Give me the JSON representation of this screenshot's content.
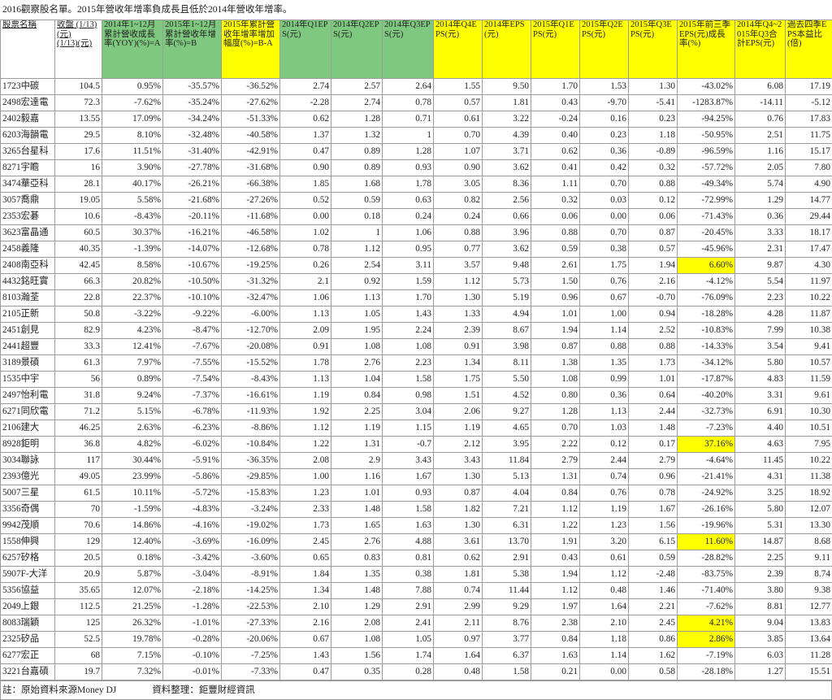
{
  "title": "2016觀察股名單。2015年營收年增率負成長且低於2014年營收年增率。",
  "colors": {
    "header_green": "#7fc87f",
    "header_yellow": "#ffff00",
    "highlight": "#ffff00",
    "grid": "#9b9b9b"
  },
  "columns": [
    {
      "label": "股票名稱",
      "style": "plain",
      "underline": true
    },
    {
      "label": "收盤\n(1/13)(元)",
      "style": "plain",
      "underline": true
    },
    {
      "label": "2014年1~12月累計營收成長率(YOY)(%)=A",
      "style": "green"
    },
    {
      "label": "2015年1~12月累計營收年增率(%)=B",
      "style": "green"
    },
    {
      "label": "2015年累計營收年增率增加幅度(%)=B-A",
      "style": "yellow"
    },
    {
      "label": "2014年Q1EPS(元)",
      "style": "green"
    },
    {
      "label": "2014年Q2EPS(元)",
      "style": "green"
    },
    {
      "label": "2014年Q3EPS(元)",
      "style": "green"
    },
    {
      "label": "2014年Q4EPS(元)",
      "style": "yellow"
    },
    {
      "label": "2014年EPS(元)",
      "style": "yellow"
    },
    {
      "label": "2015年Q1EPS(元)",
      "style": "yellow"
    },
    {
      "label": "2015年Q2EPS(元)",
      "style": "yellow"
    },
    {
      "label": "2015年Q3EPS(元)",
      "style": "yellow"
    },
    {
      "label": "2015年前三季EPS(元)成長率(%)",
      "style": "yellow"
    },
    {
      "label": "2014年Q4~2015年Q3合計EPS(元)",
      "style": "yellow"
    },
    {
      "label": "過去四季EPS本益比(倍)",
      "style": "yellow"
    }
  ],
  "rows": [
    {
      "cells": [
        "1723中碳",
        "104.5",
        "0.95%",
        "-35.57%",
        "-36.52%",
        "2.74",
        "2.57",
        "2.64",
        "1.55",
        "9.50",
        "1.70",
        "1.53",
        "1.30",
        "-43.02%",
        "6.08",
        "17.19"
      ],
      "mark": false
    },
    {
      "cells": [
        "2498宏達電",
        "72.3",
        "-7.62%",
        "-35.24%",
        "-27.62%",
        "-2.28",
        "2.74",
        "0.78",
        "0.57",
        "1.81",
        "0.43",
        "-9.70",
        "-5.41",
        "-1283.87%",
        "-14.11",
        "-5.12"
      ],
      "mark": false
    },
    {
      "cells": [
        "2402毅嘉",
        "13.55",
        "17.09%",
        "-34.24%",
        "-51.33%",
        "0.62",
        "1.28",
        "0.71",
        "0.61",
        "3.22",
        "-0.24",
        "0.16",
        "0.23",
        "-94.25%",
        "0.76",
        "17.83"
      ],
      "mark": false
    },
    {
      "cells": [
        "6203海韻電",
        "29.5",
        "8.10%",
        "-32.48%",
        "-40.58%",
        "1.37",
        "1.32",
        "1",
        "0.70",
        "4.39",
        "0.40",
        "0.23",
        "1.18",
        "-50.95%",
        "2.51",
        "11.75"
      ],
      "mark": false
    },
    {
      "cells": [
        "3265台星科",
        "17.6",
        "11.51%",
        "-31.40%",
        "-42.91%",
        "0.47",
        "0.89",
        "1.28",
        "1.07",
        "3.71",
        "0.62",
        "0.36",
        "-0.89",
        "-96.59%",
        "1.16",
        "15.17"
      ],
      "mark": false
    },
    {
      "cells": [
        "8271宇瞻",
        "16",
        "3.90%",
        "-27.78%",
        "-31.68%",
        "0.90",
        "0.89",
        "0.93",
        "0.90",
        "3.62",
        "0.41",
        "0.42",
        "0.32",
        "-57.72%",
        "2.05",
        "7.80"
      ],
      "mark": false
    },
    {
      "cells": [
        "3474華亞科",
        "28.1",
        "40.17%",
        "-26.21%",
        "-66.38%",
        "1.85",
        "1.68",
        "1.78",
        "3.05",
        "8.36",
        "1.11",
        "0.70",
        "0.88",
        "-49.34%",
        "5.74",
        "4.90"
      ],
      "mark": false
    },
    {
      "cells": [
        "3057喬鼎",
        "19.05",
        "5.58%",
        "-21.68%",
        "-27.26%",
        "0.52",
        "0.59",
        "0.63",
        "0.82",
        "2.56",
        "0.32",
        "0.03",
        "0.12",
        "-72.99%",
        "1.29",
        "14.77"
      ],
      "mark": false
    },
    {
      "cells": [
        "2353宏碁",
        "10.6",
        "-8.43%",
        "-20.11%",
        "-11.68%",
        "0.00",
        "0.18",
        "0.24",
        "0.24",
        "0.66",
        "0.06",
        "0.00",
        "0.06",
        "-71.43%",
        "0.36",
        "29.44"
      ],
      "mark": false
    },
    {
      "cells": [
        "3623富晶通",
        "60.5",
        "30.37%",
        "-16.21%",
        "-46.58%",
        "1.02",
        "1",
        "1.06",
        "0.88",
        "3.96",
        "0.88",
        "0.70",
        "0.87",
        "-20.45%",
        "3.33",
        "18.17"
      ],
      "mark": false
    },
    {
      "cells": [
        "2458義隆",
        "40.35",
        "-1.39%",
        "-14.07%",
        "-12.68%",
        "0.78",
        "1.12",
        "0.95",
        "0.77",
        "3.62",
        "0.59",
        "0.38",
        "0.57",
        "-45.96%",
        "2.31",
        "17.47"
      ],
      "mark": false
    },
    {
      "cells": [
        "2408南亞科",
        "42.45",
        "8.58%",
        "-10.67%",
        "-19.25%",
        "0.26",
        "2.54",
        "3.11",
        "3.57",
        "9.48",
        "2.61",
        "1.75",
        "1.94",
        "6.60%",
        "9.87",
        "4.30"
      ],
      "mark": true
    },
    {
      "cells": [
        "4432銘旺實",
        "66.3",
        "20.82%",
        "-10.50%",
        "-31.32%",
        "2.1",
        "0.92",
        "1.59",
        "1.12",
        "5.73",
        "1.50",
        "0.76",
        "2.16",
        "-4.12%",
        "5.54",
        "11.97"
      ],
      "mark": false
    },
    {
      "cells": [
        "8103瀚荃",
        "22.8",
        "22.37%",
        "-10.10%",
        "-32.47%",
        "1.06",
        "1.13",
        "1.70",
        "1.30",
        "5.19",
        "0.96",
        "0.67",
        "-0.70",
        "-76.09%",
        "2.23",
        "10.22"
      ],
      "mark": false
    },
    {
      "cells": [
        "2105正新",
        "50.8",
        "-3.22%",
        "-9.22%",
        "-6.00%",
        "1.13",
        "1.05",
        "1.43",
        "1.33",
        "4.94",
        "1.01",
        "1.00",
        "0.94",
        "-18.28%",
        "4.28",
        "11.87"
      ],
      "mark": false
    },
    {
      "cells": [
        "2451創見",
        "82.9",
        "4.23%",
        "-8.47%",
        "-12.70%",
        "2.09",
        "1.95",
        "2.24",
        "2.39",
        "8.67",
        "1.94",
        "1.14",
        "2.52",
        "-10.83%",
        "7.99",
        "10.38"
      ],
      "mark": false
    },
    {
      "cells": [
        "2441超豐",
        "33.3",
        "12.41%",
        "-7.67%",
        "-20.08%",
        "0.91",
        "1.08",
        "1.08",
        "0.91",
        "3.98",
        "0.87",
        "0.88",
        "0.88",
        "-14.33%",
        "3.54",
        "9.41"
      ],
      "mark": false
    },
    {
      "cells": [
        "3189景碩",
        "61.3",
        "7.97%",
        "-7.55%",
        "-15.52%",
        "1.78",
        "2.76",
        "2.23",
        "1.34",
        "8.11",
        "1.38",
        "1.35",
        "1.73",
        "-34.12%",
        "5.80",
        "10.57"
      ],
      "mark": false
    },
    {
      "cells": [
        "1535中宇",
        "56",
        "0.89%",
        "-7.54%",
        "-8.43%",
        "1.13",
        "1.04",
        "1.58",
        "1.75",
        "5.50",
        "1.08",
        "0.99",
        "1.01",
        "-17.87%",
        "4.83",
        "11.59"
      ],
      "mark": false
    },
    {
      "cells": [
        "2497怡利電",
        "31.8",
        "9.24%",
        "-7.37%",
        "-16.61%",
        "1.19",
        "0.84",
        "0.98",
        "1.51",
        "4.52",
        "0.80",
        "0.36",
        "0.64",
        "-40.20%",
        "3.31",
        "9.61"
      ],
      "mark": false
    },
    {
      "cells": [
        "6271同欣電",
        "71.2",
        "5.15%",
        "-6.78%",
        "-11.93%",
        "1.92",
        "2.25",
        "3.04",
        "2.06",
        "9.27",
        "1.28",
        "1.13",
        "2.44",
        "-32.73%",
        "6.91",
        "10.30"
      ],
      "mark": false
    },
    {
      "cells": [
        "2106建大",
        "46.25",
        "2.63%",
        "-6.23%",
        "-8.86%",
        "1.12",
        "1.19",
        "1.15",
        "1.19",
        "4.65",
        "0.70",
        "1.03",
        "1.48",
        "-7.23%",
        "4.40",
        "10.51"
      ],
      "mark": false
    },
    {
      "cells": [
        "8928鉅明",
        "36.8",
        "4.82%",
        "-6.02%",
        "-10.84%",
        "1.22",
        "1.31",
        "-0.7",
        "2.12",
        "3.95",
        "2.22",
        "0.12",
        "0.17",
        "37.16%",
        "4.63",
        "7.95"
      ],
      "mark": true
    },
    {
      "cells": [
        "3034聯詠",
        "117",
        "30.44%",
        "-5.91%",
        "-36.35%",
        "2.08",
        "2.9",
        "3.43",
        "3.43",
        "11.84",
        "2.79",
        "2.44",
        "2.79",
        "-4.64%",
        "11.45",
        "10.22"
      ],
      "mark": false
    },
    {
      "cells": [
        "2393億光",
        "49.05",
        "23.99%",
        "-5.86%",
        "-29.85%",
        "1.00",
        "1.16",
        "1.67",
        "1.30",
        "5.13",
        "1.31",
        "0.74",
        "0.96",
        "-21.41%",
        "4.31",
        "11.38"
      ],
      "mark": false
    },
    {
      "cells": [
        "5007三星",
        "61.5",
        "10.11%",
        "-5.72%",
        "-15.83%",
        "1.23",
        "1.01",
        "0.93",
        "0.87",
        "4.04",
        "0.84",
        "0.76",
        "0.78",
        "-24.92%",
        "3.25",
        "18.92"
      ],
      "mark": false
    },
    {
      "cells": [
        "3356奇偶",
        "70",
        "-1.59%",
        "-4.83%",
        "-3.24%",
        "2.33",
        "1.48",
        "1.58",
        "1.82",
        "7.21",
        "1.12",
        "1.19",
        "1.67",
        "-26.16%",
        "5.80",
        "12.07"
      ],
      "mark": false
    },
    {
      "cells": [
        "9942茂順",
        "70.6",
        "14.86%",
        "-4.16%",
        "-19.02%",
        "1.73",
        "1.65",
        "1.63",
        "1.30",
        "6.31",
        "1.22",
        "1.23",
        "1.56",
        "-19.96%",
        "5.31",
        "13.30"
      ],
      "mark": false
    },
    {
      "cells": [
        "1558伸興",
        "129",
        "12.40%",
        "-3.69%",
        "-16.09%",
        "2.45",
        "2.76",
        "4.88",
        "3.61",
        "13.70",
        "1.91",
        "3.20",
        "6.15",
        "11.60%",
        "14.87",
        "8.68"
      ],
      "mark": true
    },
    {
      "cells": [
        "6257矽格",
        "20.5",
        "0.18%",
        "-3.42%",
        "-3.60%",
        "0.65",
        "0.83",
        "0.81",
        "0.62",
        "2.91",
        "0.43",
        "0.61",
        "0.59",
        "-28.82%",
        "2.25",
        "9.11"
      ],
      "mark": false
    },
    {
      "cells": [
        "5907F-大洋",
        "20.9",
        "5.87%",
        "-3.04%",
        "-8.91%",
        "1.84",
        "1.35",
        "0.38",
        "1.81",
        "5.38",
        "1.94",
        "1.12",
        "-2.48",
        "-83.75%",
        "2.39",
        "8.74"
      ],
      "mark": false
    },
    {
      "cells": [
        "5356協益",
        "35.65",
        "12.07%",
        "-2.18%",
        "-14.25%",
        "1.34",
        "1.48",
        "7.88",
        "0.74",
        "11.44",
        "1.12",
        "0.48",
        "1.46",
        "-71.40%",
        "3.80",
        "9.38"
      ],
      "mark": false
    },
    {
      "cells": [
        "2049上銀",
        "112.5",
        "21.25%",
        "-1.28%",
        "-22.53%",
        "2.10",
        "1.29",
        "2.91",
        "2.99",
        "9.29",
        "1.97",
        "1.64",
        "2.21",
        "-7.62%",
        "8.81",
        "12.77"
      ],
      "mark": false
    },
    {
      "cells": [
        "8083瑞穎",
        "125",
        "26.32%",
        "-1.01%",
        "-27.33%",
        "2.16",
        "2.08",
        "2.41",
        "2.11",
        "8.76",
        "2.38",
        "2.10",
        "2.45",
        "4.21%",
        "9.04",
        "13.83"
      ],
      "mark": true
    },
    {
      "cells": [
        "2325矽品",
        "52.5",
        "19.78%",
        "-0.28%",
        "-20.06%",
        "0.67",
        "1.08",
        "1.05",
        "0.97",
        "3.77",
        "0.84",
        "1.18",
        "0.86",
        "2.86%",
        "3.85",
        "13.64"
      ],
      "mark": true
    },
    {
      "cells": [
        "6277宏正",
        "68",
        "7.15%",
        "-0.10%",
        "-7.25%",
        "1.43",
        "1.56",
        "1.74",
        "1.64",
        "6.37",
        "1.63",
        "1.14",
        "1.62",
        "-7.19%",
        "6.03",
        "11.28"
      ],
      "mark": false
    },
    {
      "cells": [
        "3221台嘉碩",
        "19.7",
        "7.32%",
        "-0.01%",
        "-7.33%",
        "0.47",
        "0.35",
        "0.28",
        "0.48",
        "1.58",
        "0.21",
        "0.00",
        "0.58",
        "-28.18%",
        "1.27",
        "15.51"
      ],
      "mark": false
    }
  ],
  "footer": {
    "source_note": "註：原始資料來源Money DJ",
    "compiled_note": "資料整理：鉅豐財經資訊"
  }
}
